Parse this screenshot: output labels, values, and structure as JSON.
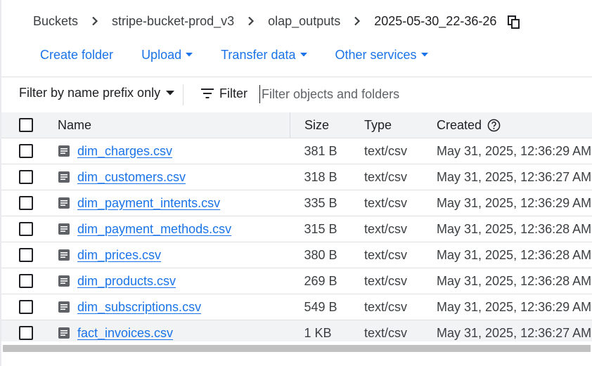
{
  "breadcrumb": {
    "items": [
      "Buckets",
      "stripe-bucket-prod_v3",
      "olap_outputs"
    ],
    "current": "2025-05-30_22-36-26"
  },
  "actions": {
    "create_folder": "Create folder",
    "upload": "Upload",
    "transfer_data": "Transfer data",
    "other_services": "Other services"
  },
  "filter": {
    "prefix_label": "Filter by name prefix only",
    "filter_label": "Filter",
    "placeholder": "Filter objects and folders"
  },
  "table": {
    "headers": {
      "name": "Name",
      "size": "Size",
      "type": "Type",
      "created": "Created"
    },
    "rows": [
      {
        "name": "dim_charges.csv",
        "size": "381 B",
        "type": "text/csv",
        "created": "May 31, 2025, 12:36:29 AM"
      },
      {
        "name": "dim_customers.csv",
        "size": "318 B",
        "type": "text/csv",
        "created": "May 31, 2025, 12:36:27 AM"
      },
      {
        "name": "dim_payment_intents.csv",
        "size": "335 B",
        "type": "text/csv",
        "created": "May 31, 2025, 12:36:29 AM"
      },
      {
        "name": "dim_payment_methods.csv",
        "size": "315 B",
        "type": "text/csv",
        "created": "May 31, 2025, 12:36:28 AM"
      },
      {
        "name": "dim_prices.csv",
        "size": "380 B",
        "type": "text/csv",
        "created": "May 31, 2025, 12:36:28 AM"
      },
      {
        "name": "dim_products.csv",
        "size": "269 B",
        "type": "text/csv",
        "created": "May 31, 2025, 12:36:28 AM"
      },
      {
        "name": "dim_subscriptions.csv",
        "size": "549 B",
        "type": "text/csv",
        "created": "May 31, 2025, 12:36:29 AM"
      },
      {
        "name": "fact_invoices.csv",
        "size": "1 KB",
        "type": "text/csv",
        "created": "May 31, 2025, 12:36:27 AM"
      }
    ]
  },
  "icons": {
    "chevron": "chevron-right-icon",
    "copy": "copy-icon",
    "dropdown": "arrow-drop-down-icon",
    "filter": "filter-list-icon",
    "file": "file-icon",
    "help": "help-icon"
  },
  "colors": {
    "link": "#1a73e8",
    "header_bg": "#f1f3f4",
    "divider": "#e0e0e0"
  }
}
